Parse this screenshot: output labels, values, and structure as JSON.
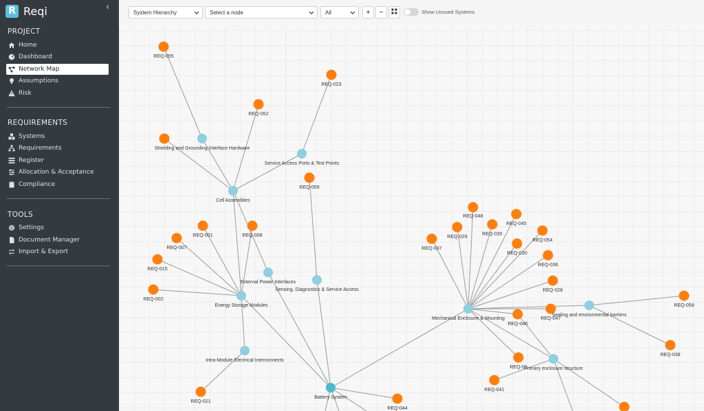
{
  "app": {
    "name": "Reqi",
    "logo_letter": "R"
  },
  "sidebar": {
    "sections": [
      {
        "title": "PROJECT",
        "items": [
          {
            "label": "Home",
            "icon": "home-icon"
          },
          {
            "label": "Dashboard",
            "icon": "dashboard-icon"
          },
          {
            "label": "Network Map",
            "icon": "network-icon",
            "active": true
          },
          {
            "label": "Assumptions",
            "icon": "lightbulb-icon"
          },
          {
            "label": "Risk",
            "icon": "warning-icon"
          }
        ]
      },
      {
        "title": "REQUIREMENTS",
        "items": [
          {
            "label": "Systems",
            "icon": "cubes-icon"
          },
          {
            "label": "Requirements",
            "icon": "sitemap-icon"
          },
          {
            "label": "Register",
            "icon": "list-icon"
          },
          {
            "label": "Allocation & Acceptance",
            "icon": "sliders-icon"
          },
          {
            "label": "Compliance",
            "icon": "clipboard-icon"
          }
        ]
      },
      {
        "title": "TOOLS",
        "items": [
          {
            "label": "Settings",
            "icon": "gear-icon"
          },
          {
            "label": "Document Manager",
            "icon": "file-icon"
          },
          {
            "label": "Import & Export",
            "icon": "exchange-icon"
          }
        ]
      }
    ]
  },
  "toolbar": {
    "view_select": "System Hierarchy",
    "node_select": "Select a node",
    "filter_select": "All",
    "zoom_in": "+",
    "zoom_out": "−",
    "fit": "⛶",
    "toggle_label": "Show Unused Systems",
    "toggle_on": false
  },
  "colors": {
    "requirement": "#ff7f0e",
    "system": "#8ecfe0",
    "root": "#4bb8cc",
    "edge": "#999999",
    "sidebar_bg": "#343a40"
  },
  "network": {
    "nodes": [
      {
        "id": "REQ-055",
        "type": "requirement"
      },
      {
        "id": "REQ-023",
        "type": "requirement"
      },
      {
        "id": "REQ-052",
        "type": "requirement"
      },
      {
        "id": "Shielding and Grounding Interface Hardware",
        "type": "system"
      },
      {
        "id": "REQ-SG",
        "type": "requirement",
        "label": ""
      },
      {
        "id": "Service Access Ports & Test Points",
        "type": "system"
      },
      {
        "id": "REQ-059",
        "type": "requirement"
      },
      {
        "id": "Cell Assemblies",
        "type": "system"
      },
      {
        "id": "REQ-001",
        "type": "requirement"
      },
      {
        "id": "REQ-008",
        "type": "requirement"
      },
      {
        "id": "REQ-007",
        "type": "requirement"
      },
      {
        "id": "REQ-015",
        "type": "requirement"
      },
      {
        "id": "REQ-002",
        "type": "requirement"
      },
      {
        "id": "External Power Interfaces",
        "type": "system"
      },
      {
        "id": "Sensing, Diagnostics & Service Access",
        "type": "system"
      },
      {
        "id": "Energy Storage Modules",
        "type": "system"
      },
      {
        "id": "Intra-Module Electrical Interconnects",
        "type": "system"
      },
      {
        "id": "REQ-021",
        "type": "requirement"
      },
      {
        "id": "Battery System",
        "type": "root"
      },
      {
        "id": "REQ-044",
        "type": "requirement"
      },
      {
        "id": "REQ-048",
        "type": "requirement"
      },
      {
        "id": "REQ-045",
        "type": "requirement"
      },
      {
        "id": "REQ-029",
        "type": "requirement"
      },
      {
        "id": "REQ-035",
        "type": "requirement"
      },
      {
        "id": "REQ-054",
        "type": "requirement"
      },
      {
        "id": "REQ-037",
        "type": "requirement"
      },
      {
        "id": "REQ-030",
        "type": "requirement"
      },
      {
        "id": "REQ-036",
        "type": "requirement"
      },
      {
        "id": "REQ-028",
        "type": "requirement"
      },
      {
        "id": "Mechanical Enclosure & Mounting",
        "type": "system"
      },
      {
        "id": "REQ-047",
        "type": "requirement"
      },
      {
        "id": "Sealing and environmental barriers",
        "type": "system"
      },
      {
        "id": "REQ-046",
        "type": "requirement"
      },
      {
        "id": "REQ-058",
        "type": "requirement"
      },
      {
        "id": "REQ-038",
        "type": "requirement"
      },
      {
        "id": "REQ-032",
        "type": "requirement",
        "label": "REQ-03"
      },
      {
        "id": "Primary enclosure structure",
        "type": "system"
      },
      {
        "id": "REQ-041",
        "type": "requirement"
      },
      {
        "id": "REQ-BR",
        "type": "requirement",
        "label": ""
      }
    ],
    "links": [
      [
        "REQ-055",
        "Shielding and Grounding Interface Hardware"
      ],
      [
        "Shielding and Grounding Interface Hardware",
        "Cell Assemblies"
      ],
      [
        "REQ-SG",
        "Cell Assemblies"
      ],
      [
        "REQ-052",
        "Cell Assemblies"
      ],
      [
        "REQ-023",
        "Service Access Ports & Test Points"
      ],
      [
        "Service Access Ports & Test Points",
        "Cell Assemblies"
      ],
      [
        "REQ-059",
        "Sensing, Diagnostics & Service Access"
      ],
      [
        "Cell Assemblies",
        "Energy Storage Modules"
      ],
      [
        "Cell Assemblies",
        "External Power Interfaces"
      ],
      [
        "REQ-001",
        "Energy Storage Modules"
      ],
      [
        "REQ-008",
        "Energy Storage Modules"
      ],
      [
        "REQ-007",
        "Energy Storage Modules"
      ],
      [
        "REQ-015",
        "Energy Storage Modules"
      ],
      [
        "REQ-002",
        "Energy Storage Modules"
      ],
      [
        "External Power Interfaces",
        "Battery System"
      ],
      [
        "Sensing, Diagnostics & Service Access",
        "Battery System"
      ],
      [
        "Energy Storage Modules",
        "Battery System"
      ],
      [
        "Energy Storage Modules",
        "Intra-Module Electrical Interconnects"
      ],
      [
        "Intra-Module Electrical Interconnects",
        "REQ-021"
      ],
      [
        "REQ-044",
        "Battery System"
      ],
      [
        "Mechanical Enclosure & Mounting",
        "Battery System"
      ],
      [
        "REQ-048",
        "Mechanical Enclosure & Mounting"
      ],
      [
        "REQ-045",
        "Mechanical Enclosure & Mounting"
      ],
      [
        "REQ-029",
        "Mechanical Enclosure & Mounting"
      ],
      [
        "REQ-035",
        "Mechanical Enclosure & Mounting"
      ],
      [
        "REQ-054",
        "Mechanical Enclosure & Mounting"
      ],
      [
        "REQ-037",
        "Mechanical Enclosure & Mounting"
      ],
      [
        "REQ-030",
        "Mechanical Enclosure & Mounting"
      ],
      [
        "REQ-036",
        "Mechanical Enclosure & Mounting"
      ],
      [
        "REQ-028",
        "Mechanical Enclosure & Mounting"
      ],
      [
        "REQ-047",
        "Mechanical Enclosure & Mounting"
      ],
      [
        "Sealing and environmental barriers",
        "Mechanical Enclosure & Mounting"
      ],
      [
        "REQ-046",
        "Mechanical Enclosure & Mounting"
      ],
      [
        "REQ-032",
        "Mechanical Enclosure & Mounting"
      ],
      [
        "Primary enclosure structure",
        "Mechanical Enclosure & Mounting"
      ],
      [
        "REQ-058",
        "Sealing and environmental barriers"
      ],
      [
        "REQ-038",
        "Sealing and environmental barriers"
      ],
      [
        "REQ-046",
        "Primary enclosure structure"
      ],
      [
        "REQ-041",
        "Primary enclosure structure"
      ],
      [
        "REQ-BR",
        "Primary enclosure structure"
      ]
    ]
  }
}
